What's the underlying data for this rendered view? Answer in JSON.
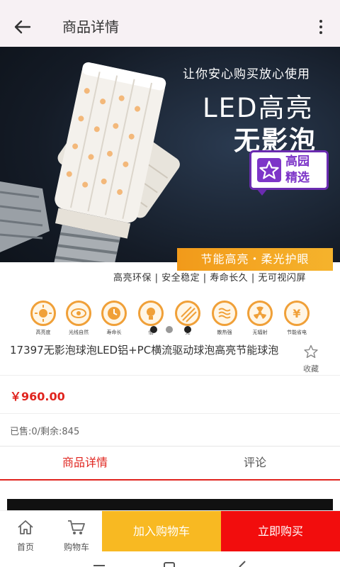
{
  "header": {
    "title": "商品详情"
  },
  "hero": {
    "tagline": "让你安心购买放心使用",
    "headline_1": "LED高亮",
    "headline_2": "无影泡",
    "badge_line_1": "高园",
    "badge_line_2": "精选",
    "orange_band": "节能高亮・柔光护眼",
    "features_line": "高亮环保 | 安全稳定 | 寿命长久 | 无可视闪屏"
  },
  "feature_icons": [
    {
      "label": "高亮度",
      "icon": "sun-icon"
    },
    {
      "label": "光线自然",
      "icon": "eye-icon"
    },
    {
      "label": "寿命长",
      "icon": "clock-icon"
    },
    {
      "label": "低",
      "icon": "bulb-icon"
    },
    {
      "label": "无",
      "icon": "stripes-icon"
    },
    {
      "label": "散热强",
      "icon": "waves-icon"
    },
    {
      "label": "无辐射",
      "icon": "radiation-icon"
    },
    {
      "label": "节能省电",
      "icon": "yen-icon"
    }
  ],
  "carousel": {
    "dot_count": 3,
    "active_index": 1
  },
  "product": {
    "name": "17397无影泡球泡LED铝+PC横流驱动球泡高亮节能球泡",
    "favorite_label": "收藏",
    "price": "￥960.00",
    "stock": "已售:0/剩余:845"
  },
  "tabs": [
    {
      "label": "商品详情",
      "active": true
    },
    {
      "label": "评论",
      "active": false
    }
  ],
  "bottom_bar": {
    "home_label": "首页",
    "cart_label": "购物车",
    "add_to_cart": "加入购物车",
    "buy_now": "立即购买"
  },
  "colors": {
    "accent": "#e0241e",
    "cart_button": "#f8b922",
    "buy_button": "#f20d0d",
    "icon_orange": "#f0a038",
    "badge_purple": "#7d35c8"
  }
}
